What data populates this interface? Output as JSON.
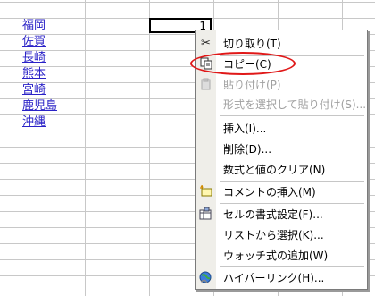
{
  "sheet": {
    "cities": [
      "福岡",
      "佐賀",
      "長崎",
      "熊本",
      "宮崎",
      "鹿児島",
      "沖縄"
    ],
    "active_cell_value": "1"
  },
  "context_menu": {
    "items": [
      {
        "label": "切り取り(T)",
        "icon": "scissors-icon"
      },
      {
        "label": "コピー(C)",
        "icon": "copy-icon"
      },
      {
        "label": "貼り付け(P)",
        "icon": "paste-icon"
      },
      {
        "label": "形式を選択して貼り付け(S)...",
        "icon": ""
      },
      {
        "label": "挿入(I)...",
        "icon": ""
      },
      {
        "label": "削除(D)...",
        "icon": ""
      },
      {
        "label": "数式と値のクリア(N)",
        "icon": ""
      },
      {
        "label": "コメントの挿入(M)",
        "icon": "insert-comment-icon"
      },
      {
        "label": "セルの書式設定(F)...",
        "icon": "format-cells-icon"
      },
      {
        "label": "リストから選択(K)...",
        "icon": ""
      },
      {
        "label": "ウォッチ式の追加(W)",
        "icon": ""
      },
      {
        "label": "ハイパーリンク(H)...",
        "icon": "hyperlink-globe-icon"
      }
    ],
    "disabled_items": [
      "貼り付け(P)",
      "形式を選択して貼り付け(S)..."
    ]
  },
  "colors": {
    "link": "#2a22c7",
    "highlight_oval": "#e01818",
    "menu_strip": "#efeee9"
  }
}
